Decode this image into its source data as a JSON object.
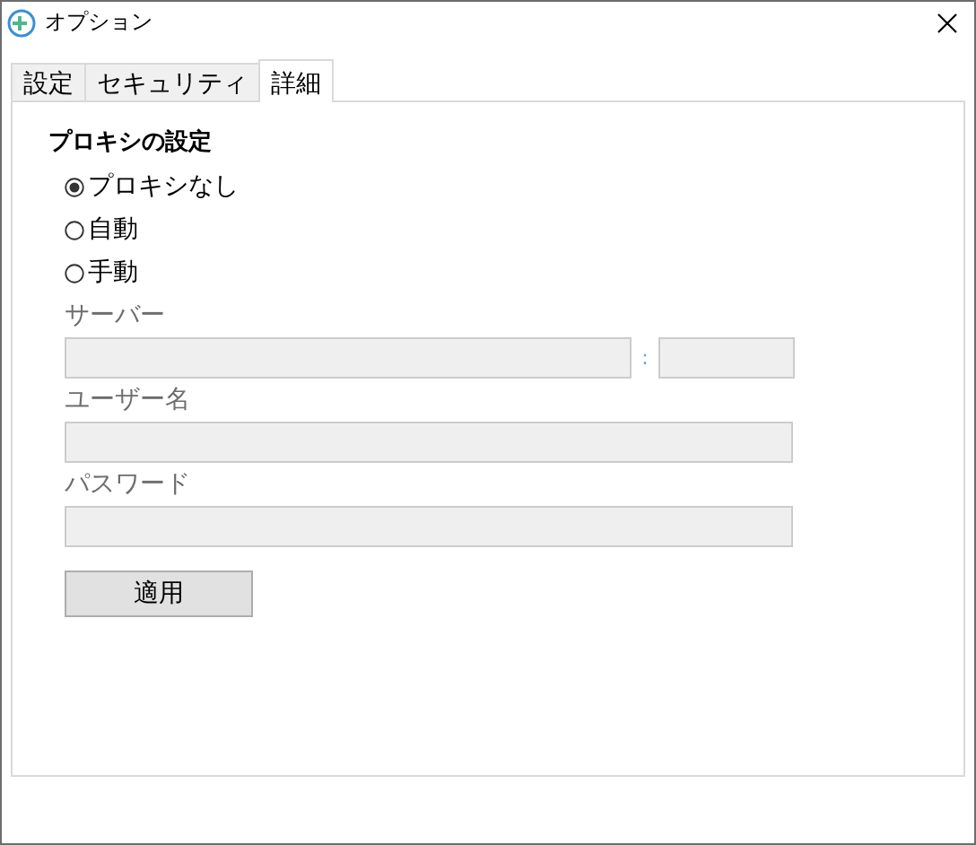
{
  "window": {
    "title": "オプション"
  },
  "tabs": [
    {
      "label": "設定",
      "selected": false
    },
    {
      "label": "セキュリティ",
      "selected": false
    },
    {
      "label": "詳細",
      "selected": true
    }
  ],
  "proxy": {
    "heading": "プロキシの設定",
    "modes": [
      {
        "label": "プロキシなし",
        "selected": true
      },
      {
        "label": "自動",
        "selected": false
      },
      {
        "label": "手動",
        "selected": false
      }
    ],
    "server": {
      "label": "サーバー",
      "separator": ":",
      "disabled": true
    },
    "username": {
      "label": "ユーザー名",
      "disabled": true
    },
    "password": {
      "label": "パスワード",
      "disabled": true
    },
    "apply_button": "適用"
  }
}
